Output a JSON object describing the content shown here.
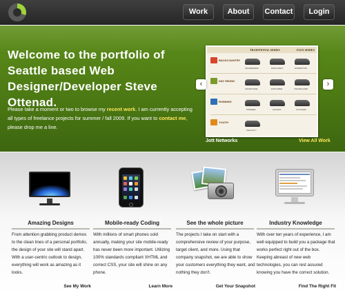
{
  "header": {
    "nav": {
      "work": "Work",
      "about": "About",
      "contact": "Contact",
      "login": "Login"
    }
  },
  "hero": {
    "title": "Welcome to the portfolio of Seattle based Web Designer/Developer Steve Ottenad.",
    "body_1": "Please take a moment or two to browse my ",
    "body_link_work": "recent work",
    "body_2": ". I am currently accepting all types of freelance projects for summer / fall 2009. If you want to ",
    "body_link_contact": "contact me",
    "body_3": ", please drop me a line."
  },
  "slider": {
    "caption": "Jott Networks",
    "view_all": "View All Work",
    "prev_label": "‹",
    "next_label": "›",
    "screenshot": {
      "heading_a": "TRADITIONAL SERIES",
      "heading_b": "FLEX SERIES",
      "rows": [
        {
          "tag": "BACKCOUNTRY",
          "color": "#d8452b",
          "items": [
            "WILDERNESS",
            "DISCOVERY",
            "EXPEDITION"
          ]
        },
        {
          "tag": "DAY HIKING",
          "color": "#7a9a2a",
          "items": [
            "ADVENTURE",
            "EXPLORER",
            "TRAILBLAZER"
          ]
        },
        {
          "tag": "RUNNING",
          "color": "#2f6fb5",
          "items": [
            "PIONEER",
            "ACCESS",
            "VOYAGER"
          ]
        },
        {
          "tag": "YOUTH",
          "color": "#e08a1e",
          "items": [
            "VELOCITY"
          ]
        }
      ]
    }
  },
  "features": [
    {
      "title": "Amazing Designs",
      "text": "From attention grabbing product demos to the clean lines of a personal portfolio, the design of your site will stand apart. With a user-centric outlook to design, everything will work as amazing as it looks.",
      "link": "See My Work"
    },
    {
      "title": "Mobile-ready Coding",
      "text": "With millions of smart phones sold annually, making your site mobile-ready has never been more important. Utilizing 100% standards compliant XHTML and correct CSS, your site will shine on any phone.",
      "link": "Learn More"
    },
    {
      "title": "See the whole picture",
      "text": "The projects I take on start with a comprehensive review of your purpose, target client, and more. Using that company snapshot, we are able to show your customers everything they want, and nothing they don't.",
      "link": "Get Your Snapshot"
    },
    {
      "title": "Industry Knowledge",
      "text": "With over ten years of experience, I am well equipped to build you a package that works perfect right out of the box. Keeping abreast of new web technologies, you can rest assured knowing you have the correct solution.",
      "link": "Find The Right Fit"
    }
  ],
  "colors": {
    "hero_green": "#4b7813",
    "highlight_yellow": "#ffe75a",
    "header_dark": "#2c2c2c"
  }
}
